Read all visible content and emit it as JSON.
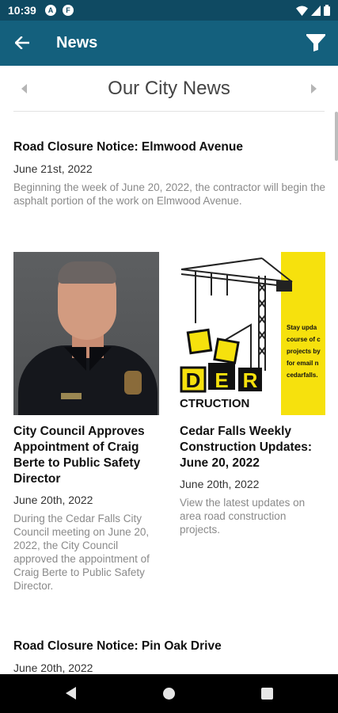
{
  "status_bar": {
    "time": "10:39",
    "badges": [
      "A",
      "F"
    ],
    "icons": [
      "wifi-icon",
      "signal-icon",
      "battery-icon"
    ]
  },
  "app_bar": {
    "title": "News",
    "back_icon": "arrow-left-icon",
    "filter_icon": "filter-icon",
    "color": "#14607d"
  },
  "section": {
    "title": "Our City News"
  },
  "articles": [
    {
      "title": "Road Closure Notice: Elmwood Avenue",
      "date": "June 21st, 2022",
      "excerpt": "Beginning the week of June 20, 2022, the contractor will begin the asphalt portion of the work on Elmwood Avenue."
    },
    {
      "title": "City Council Approves Appointment of Craig Berte to Public Safety Director",
      "date": "June 20th, 2022",
      "excerpt": "During the Cedar Falls City Council meeting on June 20, 2022, the City Council approved the appointment of Craig Berte to Public Safety Director."
    },
    {
      "title": "Cedar Falls Weekly Construction Updates: June 20, 2022",
      "date": "June 20th, 2022",
      "excerpt": "View the latest updates on area road construction projects.",
      "image_text": {
        "sign_letters": "DER",
        "banner": "CTRUCTION",
        "side_lines": [
          "Stay upda",
          "course of c",
          "projects by",
          "for email n",
          "cedarfalls."
        ]
      }
    },
    {
      "title": "Road Closure Notice: Pin Oak Drive",
      "date": "June 20th, 2022"
    }
  ],
  "nav_bar": {
    "icons": [
      "back-triangle-icon",
      "home-circle-icon",
      "recents-square-icon"
    ]
  }
}
